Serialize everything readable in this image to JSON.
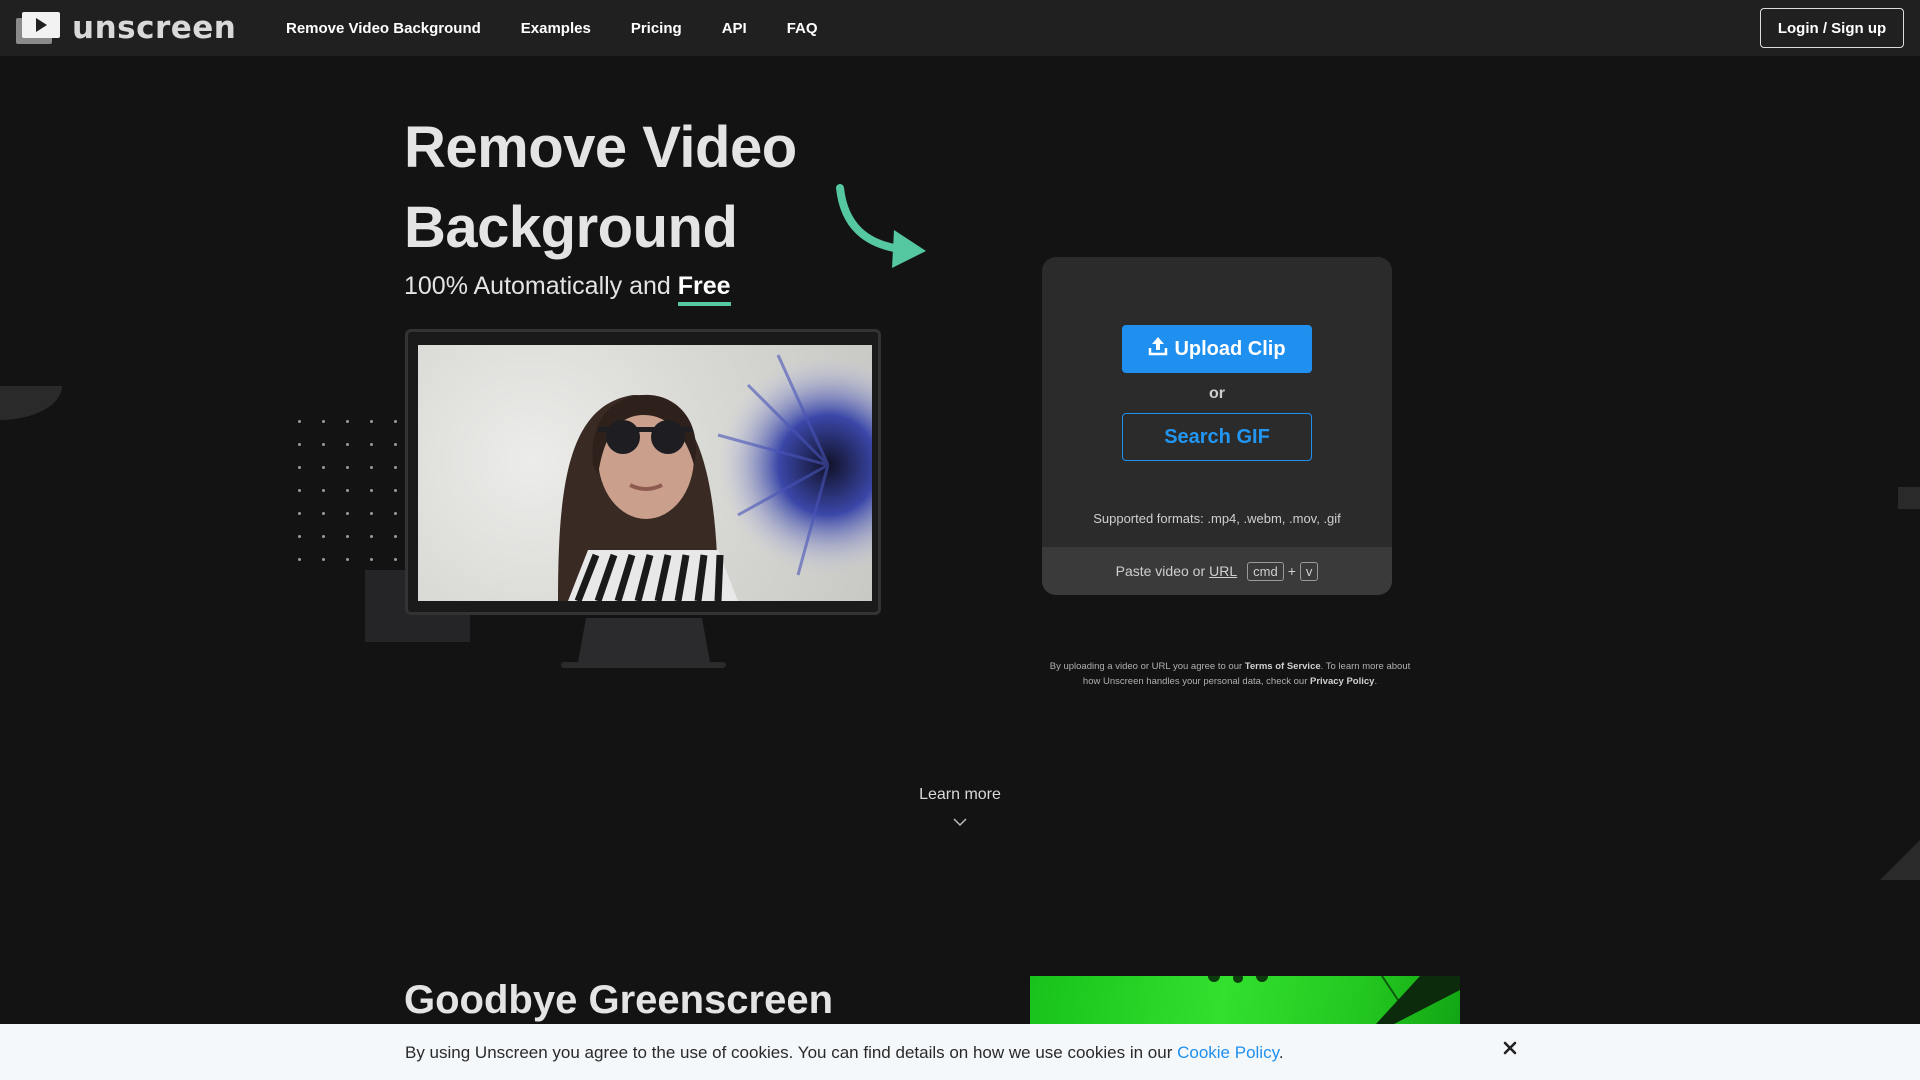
{
  "brand": {
    "name": "unscreen"
  },
  "nav": {
    "links": [
      "Remove Video Background",
      "Examples",
      "Pricing",
      "API",
      "FAQ"
    ],
    "login": "Login / Sign up"
  },
  "hero": {
    "title_line1": "Remove Video",
    "title_line2": "Background",
    "subtitle_prefix": "100% Automatically and ",
    "subtitle_emphasis": "Free"
  },
  "upload_card": {
    "upload_label": "Upload Clip",
    "or": "or",
    "gif_label": "Search GIF",
    "formats": "Supported formats: .mp4, .webm, .mov, .gif",
    "paste_prefix": "Paste video or",
    "paste_url": "URL",
    "key_cmd": "cmd",
    "key_plus": "+",
    "key_v": "v"
  },
  "legal": {
    "part1": "By uploading a video or URL you agree to our ",
    "tos": "Terms of Service",
    "part2": ". To learn more about how Unscreen handles your personal data, check our ",
    "privacy": "Privacy Policy",
    "part3": "."
  },
  "learn_more": "Learn more",
  "section2": {
    "title": "Goodbye Greenscreen"
  },
  "cookie": {
    "text": "By using Unscreen you agree to the use of cookies. You can find details on how we use cookies in our ",
    "link": "Cookie Policy",
    "end": "."
  },
  "colors": {
    "accent_blue": "#1f8ff0",
    "accent_green": "#55c7a1",
    "background": "#131314"
  },
  "icons": [
    "logo-play-icon",
    "arrow-curved-icon",
    "upload-icon",
    "chevron-down-icon",
    "close-icon"
  ]
}
